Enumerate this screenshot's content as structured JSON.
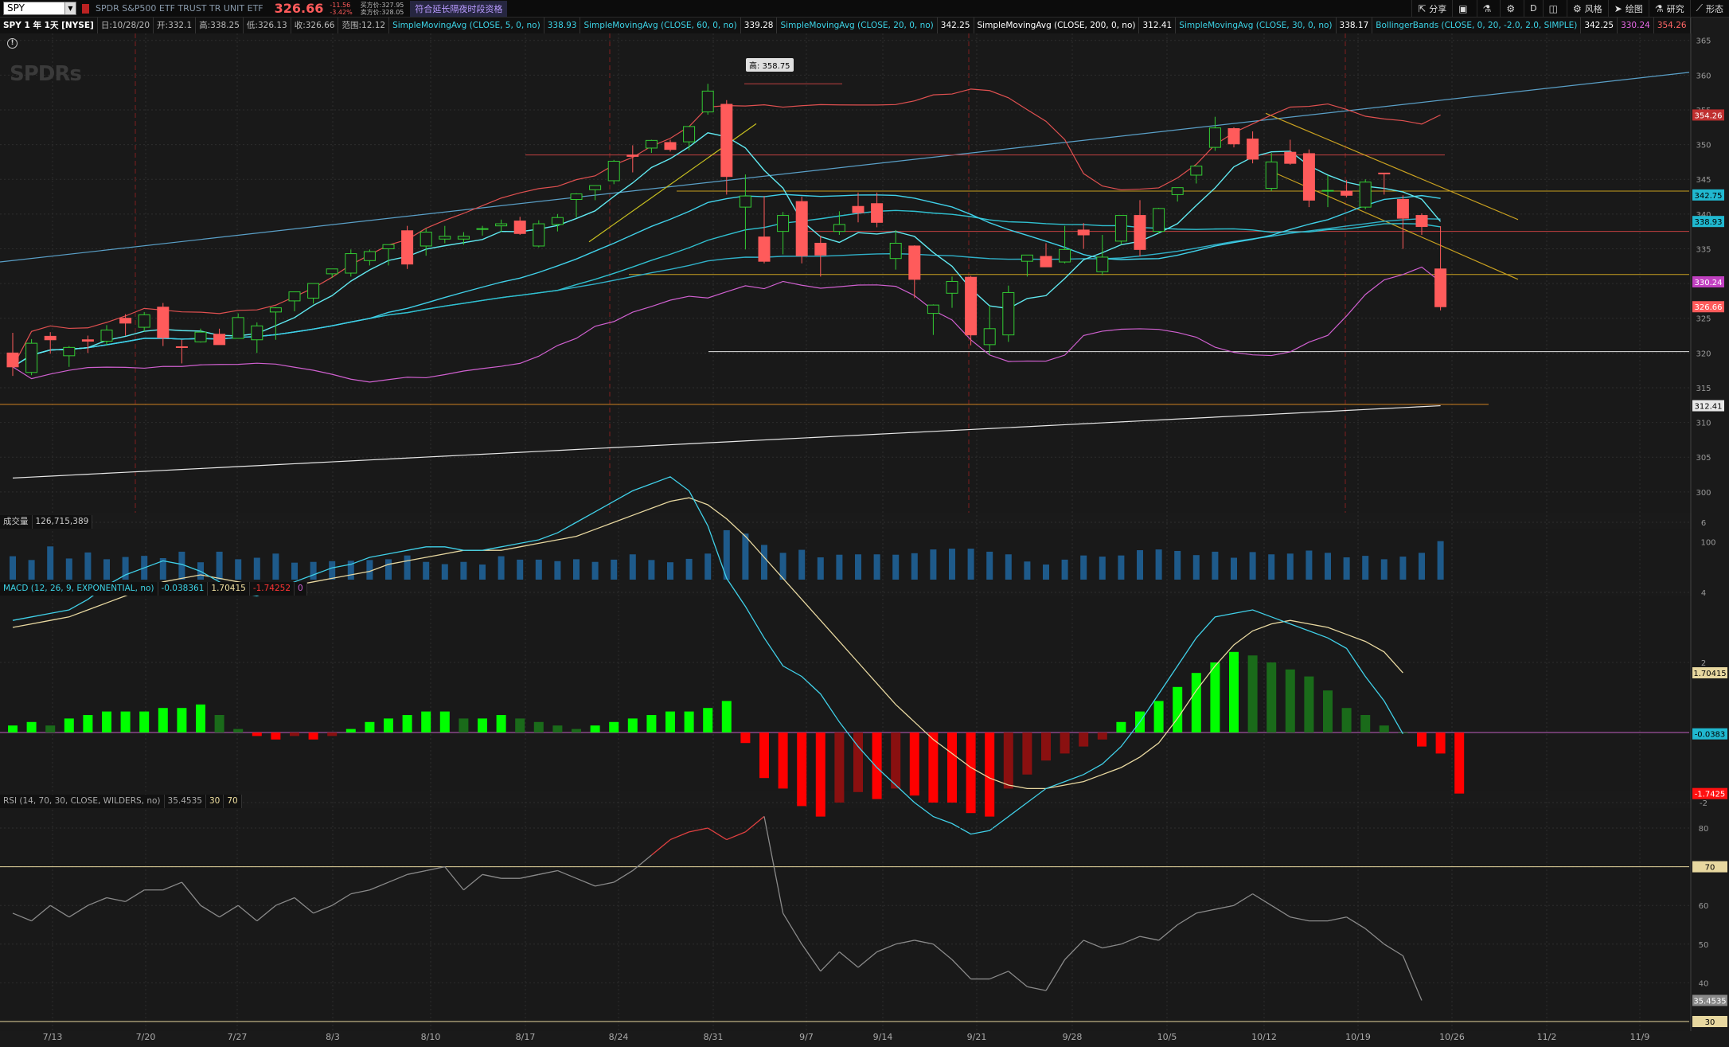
{
  "header": {
    "symbol": "SPY",
    "description": "SPDR S&P500 ETF TRUST TR UNIT ETF",
    "last": "326.66",
    "change": "-11.56",
    "change_pct": "-3.42%",
    "bid": "买方价:327.95",
    "ask": "卖方价:328.05",
    "extended_badge": "符合延长隔夜时段资格"
  },
  "toolbar": {
    "share": "分享",
    "grid_letter": "D",
    "style": "风格",
    "draw": "绘图",
    "studies": "研究",
    "patterns": "形态"
  },
  "studybar": {
    "title": "SPY 1 年 1天 [NYSE]",
    "date": "日:10/28/20",
    "open": "开:332.1",
    "high": "高:338.25",
    "low": "低:326.13",
    "close": "收:326.66",
    "range": "范围:12.12",
    "sma5": "SimpleMovingAvg (CLOSE, 5, 0, no)",
    "sma5_val": "338.93",
    "sma60": "SimpleMovingAvg (CLOSE, 60, 0, no)",
    "sma60_val": "339.28",
    "sma20": "SimpleMovingAvg (CLOSE, 20, 0, no)",
    "sma20_val": "342.25",
    "sma200": "SimpleMovingAvg (CLOSE, 200, 0, no)",
    "sma200_val": "312.41",
    "sma30": "SimpleMovingAvg (CLOSE, 30, 0, no)",
    "sma30_val": "338.17",
    "bb": "BollingerBands (CLOSE, 0, 20, -2.0, 2.0, SIMPLE)",
    "bb_mid": "342.25",
    "bb_low": "330.24",
    "bb_up": "354.26"
  },
  "volume_panel": {
    "title": "成交量",
    "value": "126,715,389"
  },
  "macd_panel": {
    "title": "MACD (12, 26, 9, EXPONENTIAL, no)",
    "value": "-0.038361",
    "avg": "1.70415",
    "diff": "-1.74252",
    "zero": "0"
  },
  "rsi_panel": {
    "title": "RSI (14, 70, 30, CLOSE, WILDERS, no)",
    "value": "35.4535",
    "os": "30",
    "ob": "70"
  },
  "price_label_high": "高: 358.75",
  "logo": "SPDRs",
  "colors": {
    "up": "#33cc33",
    "down": "#ff5b5b",
    "sma_cyan": "#3cd3e6",
    "bb_red": "#e05050",
    "bb_pink": "#d060d0",
    "sma200": "#e8e8e8",
    "macd_up": "#00ff00",
    "macd_down": "#ff0000"
  },
  "chart_data": [
    {
      "type": "candlestick",
      "x": [
        "7/13",
        "7/14",
        "7/15",
        "7/16",
        "7/17",
        "7/20",
        "7/21",
        "7/22",
        "7/23",
        "7/24",
        "7/27",
        "7/28",
        "7/29",
        "7/30",
        "7/31",
        "8/3",
        "8/4",
        "8/5",
        "8/6",
        "8/7",
        "8/10",
        "8/11",
        "8/12",
        "8/13",
        "8/14",
        "8/17",
        "8/18",
        "8/19",
        "8/20",
        "8/21",
        "8/24",
        "8/25",
        "8/26",
        "8/27",
        "8/28",
        "8/31",
        "9/1",
        "9/2",
        "9/3",
        "9/4",
        "9/8",
        "9/9",
        "9/10",
        "9/11",
        "9/14",
        "9/15",
        "9/16",
        "9/17",
        "9/18",
        "9/21",
        "9/22",
        "9/23",
        "9/24",
        "9/25",
        "9/28",
        "9/29",
        "9/30",
        "10/1",
        "10/2",
        "10/5",
        "10/6",
        "10/7",
        "10/8",
        "10/9",
        "10/12",
        "10/13",
        "10/14",
        "10/15",
        "10/16",
        "10/19",
        "10/20",
        "10/21",
        "10/22",
        "10/23",
        "10/26",
        "10/27",
        "10/28"
      ],
      "x_ticks": [
        "7/13",
        "7/20",
        "7/27",
        "8/3",
        "8/10",
        "8/17",
        "8/24",
        "8/31",
        "9/7",
        "9/14",
        "9/21",
        "9/28",
        "10/5",
        "10/12",
        "10/19",
        "10/26",
        "11/2",
        "11/9"
      ],
      "y_ticks": [
        300,
        305,
        310,
        315,
        320,
        325,
        330,
        335,
        340,
        345,
        350,
        355,
        360,
        365
      ],
      "ylim": [
        297,
        366
      ],
      "series": [
        {
          "name": "OHLC",
          "values": [
            [
              320.0,
              322.9,
              316.7,
              318.0
            ],
            [
              317.2,
              322.0,
              316.8,
              321.4
            ],
            [
              322.4,
              323.0,
              319.9,
              321.9
            ],
            [
              319.6,
              321.0,
              318.0,
              320.8
            ],
            [
              321.9,
              322.5,
              320.0,
              321.7
            ],
            [
              321.7,
              324.0,
              321.1,
              323.3
            ],
            [
              325.0,
              325.6,
              322.5,
              324.3
            ],
            [
              323.7,
              325.9,
              323.1,
              325.5
            ],
            [
              326.6,
              327.2,
              321.0,
              322.2
            ],
            [
              320.9,
              321.9,
              318.5,
              320.8
            ],
            [
              321.6,
              323.5,
              321.5,
              323.0
            ],
            [
              322.7,
              323.5,
              321.2,
              321.2
            ],
            [
              322.1,
              325.7,
              322.1,
              325.1
            ],
            [
              321.9,
              324.4,
              320.0,
              323.9
            ],
            [
              325.9,
              326.6,
              321.9,
              326.5
            ],
            [
              327.5,
              328.5,
              326.0,
              328.8
            ],
            [
              327.9,
              329.0,
              327.1,
              330.0
            ],
            [
              331.4,
              332.0,
              330.8,
              332.1
            ],
            [
              331.5,
              334.9,
              331.0,
              334.3
            ],
            [
              333.3,
              334.9,
              332.6,
              334.6
            ],
            [
              335.0,
              335.5,
              332.6,
              335.6
            ],
            [
              337.6,
              338.3,
              332.1,
              332.8
            ],
            [
              335.4,
              337.9,
              334.0,
              337.4
            ],
            [
              336.4,
              338.3,
              335.8,
              336.8
            ],
            [
              336.4,
              337.4,
              335.6,
              336.8
            ],
            [
              337.9,
              338.3,
              336.9,
              337.9
            ],
            [
              338.3,
              339.2,
              337.4,
              338.6
            ],
            [
              339.0,
              339.6,
              337.0,
              337.2
            ],
            [
              335.4,
              339.1,
              335.2,
              338.6
            ],
            [
              338.5,
              340.0,
              337.5,
              339.5
            ],
            [
              342.1,
              343.0,
              339.5,
              342.9
            ],
            [
              343.5,
              344.0,
              342.0,
              344.1
            ],
            [
              344.8,
              347.8,
              344.3,
              347.6
            ],
            [
              348.5,
              349.9,
              346.0,
              348.3
            ],
            [
              349.5,
              350.7,
              348.8,
              350.6
            ],
            [
              350.3,
              350.7,
              349.0,
              349.3
            ],
            [
              350.4,
              352.7,
              349.2,
              352.6
            ],
            [
              354.7,
              358.75,
              354.3,
              357.7
            ],
            [
              355.8,
              356.4,
              342.8,
              345.4
            ],
            [
              341.0,
              345.7,
              334.9,
              342.6
            ],
            [
              336.7,
              342.6,
              332.9,
              333.2
            ],
            [
              337.5,
              340.3,
              334.2,
              339.8
            ],
            [
              341.8,
              342.5,
              332.9,
              334.0
            ],
            [
              335.8,
              336.9,
              331.0,
              334.1
            ],
            [
              337.5,
              340.4,
              337.0,
              338.5
            ],
            [
              341.1,
              343.1,
              338.8,
              340.2
            ],
            [
              341.5,
              343.1,
              338.1,
              338.8
            ],
            [
              333.6,
              337.7,
              332.0,
              335.8
            ],
            [
              335.4,
              335.5,
              327.9,
              330.6
            ],
            [
              325.7,
              327.0,
              322.6,
              326.9
            ],
            [
              328.6,
              331.0,
              326.5,
              330.3
            ],
            [
              330.9,
              331.1,
              321.1,
              322.6
            ],
            [
              321.2,
              326.8,
              319.8,
              323.5
            ],
            [
              322.6,
              329.7,
              321.6,
              328.7
            ],
            [
              333.2,
              334.0,
              331.0,
              334.1
            ],
            [
              333.9,
              335.8,
              332.6,
              332.4
            ],
            [
              333.1,
              338.3,
              332.9,
              334.9
            ],
            [
              337.7,
              338.7,
              335.0,
              337.0
            ],
            [
              331.7,
              337.0,
              331.2,
              333.8
            ],
            [
              336.1,
              339.1,
              335.6,
              339.8
            ],
            [
              339.8,
              342.0,
              333.9,
              334.9
            ],
            [
              337.5,
              340.9,
              337.2,
              340.8
            ],
            [
              342.8,
              343.6,
              341.8,
              343.8
            ],
            [
              345.6,
              346.9,
              344.4,
              346.9
            ],
            [
              349.6,
              354.0,
              349.1,
              352.4
            ],
            [
              352.3,
              352.5,
              349.6,
              350.1
            ],
            [
              350.8,
              351.9,
              347.3,
              347.9
            ],
            [
              343.7,
              348.8,
              343.3,
              347.5
            ],
            [
              348.9,
              350.7,
              347.1,
              347.3
            ],
            [
              348.7,
              349.3,
              341.0,
              342.0
            ],
            [
              343.4,
              345.6,
              341.0,
              343.4
            ],
            [
              343.3,
              344.9,
              342.4,
              342.7
            ],
            [
              341.0,
              345.0,
              340.7,
              344.6
            ],
            [
              345.9,
              345.9,
              342.8,
              345.8
            ],
            [
              342.1,
              342.7,
              335.0,
              339.4
            ],
            [
              339.8,
              340.1,
              337.0,
              338.2
            ],
            [
              332.1,
              338.25,
              326.13,
              326.66
            ]
          ]
        },
        {
          "name": "SMA200",
          "values": [
            302.0,
            312.41
          ]
        },
        {
          "name": "SMA5",
          "values": [
            338.93
          ]
        },
        {
          "name": "SMA20",
          "values": [
            342.25
          ]
        },
        {
          "name": "SMA30",
          "values": [
            338.17
          ]
        },
        {
          "name": "SMA60",
          "values": [
            339.28
          ]
        },
        {
          "name": "BB upper",
          "values": [
            354.26
          ]
        },
        {
          "name": "BB lower",
          "values": [
            330.24
          ]
        }
      ],
      "right_labels": [
        "354.26",
        "342.75",
        "338.93",
        "330.24",
        "326.66",
        "312.41"
      ]
    },
    {
      "type": "bar",
      "title": "成交量",
      "y_ticks": [
        "100"
      ],
      "values": [
        62,
        52,
        88,
        56,
        72,
        54,
        60,
        63,
        57,
        74,
        46,
        74,
        54,
        58,
        69,
        45,
        47,
        49,
        50,
        52,
        54,
        64,
        47,
        41,
        47,
        40,
        62,
        53,
        53,
        49,
        54,
        47,
        53,
        67,
        52,
        46,
        55,
        69,
        131,
        122,
        92,
        71,
        79,
        59,
        66,
        67,
        67,
        66,
        70,
        80,
        82,
        82,
        74,
        67,
        48,
        40,
        53,
        64,
        61,
        64,
        78,
        80,
        76,
        65,
        74,
        58,
        73,
        67,
        69,
        77,
        71,
        59,
        63,
        54,
        61,
        71,
        102
      ]
    },
    {
      "type": "bar",
      "title": "MACD (12, 26, 9, EXPONENTIAL, no)",
      "y_ticks": [
        "6",
        "4",
        "2",
        "0",
        "-2"
      ],
      "histogram": [
        0.2,
        0.3,
        0.2,
        0.4,
        0.5,
        0.6,
        0.6,
        0.6,
        0.7,
        0.7,
        0.8,
        0.5,
        0.1,
        -0.1,
        -0.2,
        -0.1,
        -0.2,
        -0.1,
        0.1,
        0.3,
        0.4,
        0.5,
        0.6,
        0.6,
        0.4,
        0.4,
        0.5,
        0.4,
        0.3,
        0.2,
        0.1,
        0.2,
        0.3,
        0.4,
        0.5,
        0.6,
        0.6,
        0.7,
        0.9,
        -0.3,
        -1.3,
        -1.6,
        -2.1,
        -2.4,
        -2.0,
        -1.7,
        -1.9,
        -1.6,
        -1.8,
        -2.0,
        -2.0,
        -2.3,
        -2.4,
        -1.6,
        -1.2,
        -0.8,
        -0.6,
        -0.4,
        -0.2,
        0.3,
        0.6,
        0.9,
        1.3,
        1.7,
        2.0,
        2.3,
        2.2,
        2.0,
        1.8,
        1.6,
        1.2,
        0.7,
        0.5,
        0.2,
        0.0,
        -0.4,
        -0.6,
        -1.74252
      ],
      "macd": [
        3.2,
        3.3,
        3.4,
        3.5,
        3.8,
        4.2,
        4.5,
        4.7,
        4.9,
        4.8,
        4.6,
        4.3,
        4.0,
        3.9,
        4.1,
        4.3,
        4.5,
        4.7,
        4.8,
        5.0,
        5.1,
        5.2,
        5.3,
        5.3,
        5.2,
        5.2,
        5.3,
        5.4,
        5.5,
        5.7,
        6.0,
        6.3,
        6.6,
        6.9,
        7.1,
        7.3,
        6.9,
        5.9,
        4.4,
        3.6,
        2.7,
        1.9,
        1.6,
        1.1,
        0.3,
        -0.4,
        -1.0,
        -1.5,
        -2.0,
        -2.4,
        -2.6,
        -2.9,
        -2.8,
        -2.4,
        -2.0,
        -1.6,
        -1.4,
        -1.2,
        -0.9,
        -0.4,
        0.3,
        1.1,
        1.9,
        2.7,
        3.3,
        3.4,
        3.5,
        3.3,
        3.1,
        2.9,
        2.7,
        2.4,
        1.6,
        0.9,
        -0.038361
      ],
      "signal": [
        3.0,
        3.1,
        3.2,
        3.3,
        3.5,
        3.7,
        3.9,
        4.1,
        4.3,
        4.4,
        4.5,
        4.4,
        4.3,
        4.2,
        4.2,
        4.2,
        4.3,
        4.4,
        4.5,
        4.6,
        4.8,
        4.9,
        5.0,
        5.1,
        5.2,
        5.2,
        5.2,
        5.3,
        5.4,
        5.5,
        5.6,
        5.8,
        6.0,
        6.2,
        6.4,
        6.6,
        6.7,
        6.5,
        6.1,
        5.6,
        5.0,
        4.4,
        3.8,
        3.2,
        2.6,
        2.0,
        1.4,
        0.8,
        0.3,
        -0.2,
        -0.6,
        -1.0,
        -1.3,
        -1.5,
        -1.6,
        -1.6,
        -1.5,
        -1.4,
        -1.2,
        -1.0,
        -0.7,
        -0.3,
        0.4,
        1.2,
        1.9,
        2.5,
        2.9,
        3.1,
        3.2,
        3.1,
        3.0,
        2.8,
        2.6,
        2.3,
        1.70415
      ]
    },
    {
      "type": "line",
      "title": "RSI (14, 70, 30, CLOSE, WILDERS, no)",
      "y_ticks": [
        "80",
        "70",
        "60",
        "50",
        "40",
        "30"
      ],
      "values": [
        58,
        56,
        60,
        57,
        60,
        62,
        61,
        64,
        64,
        66,
        60,
        57,
        60,
        56,
        60,
        62,
        58,
        60,
        63,
        64,
        66,
        68,
        69,
        70,
        64,
        68,
        67,
        67,
        68,
        69,
        67,
        65,
        66,
        69,
        73,
        77,
        79,
        80,
        77,
        79,
        83,
        58,
        50,
        43,
        48,
        44,
        48,
        50,
        51,
        50,
        46,
        41,
        41,
        43,
        39,
        38,
        46,
        51,
        49,
        50,
        52,
        51,
        55,
        58,
        59,
        60,
        63,
        60,
        57,
        56,
        56,
        57,
        54,
        50,
        47,
        35.4535
      ]
    }
  ]
}
